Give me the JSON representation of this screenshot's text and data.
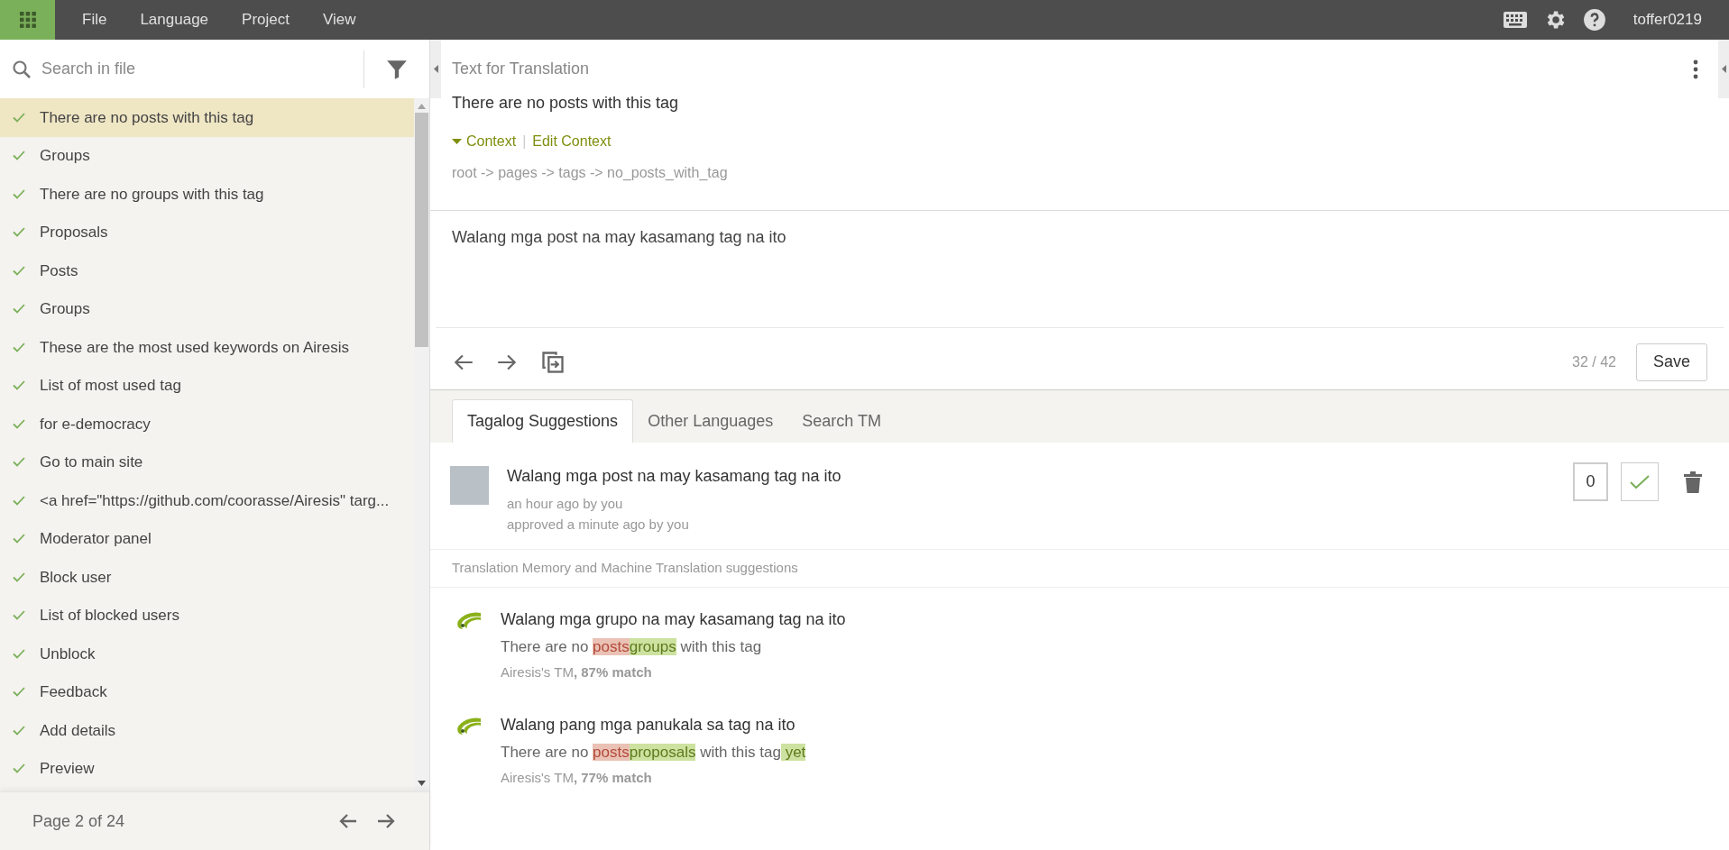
{
  "menu": [
    "File",
    "Language",
    "Project",
    "View"
  ],
  "user": "toffer0219",
  "search": {
    "placeholder": "Search in file"
  },
  "entries": [
    {
      "text": "There are no posts with this tag",
      "approved": true,
      "selected": true
    },
    {
      "text": "Groups",
      "approved": true,
      "selected": false
    },
    {
      "text": "There are no groups with this tag",
      "approved": true,
      "selected": false
    },
    {
      "text": "Proposals",
      "approved": true,
      "selected": false
    },
    {
      "text": "Posts",
      "approved": true,
      "selected": false
    },
    {
      "text": "Groups",
      "approved": true,
      "selected": false
    },
    {
      "text": "These are the most used keywords on Airesis",
      "approved": true,
      "selected": false
    },
    {
      "text": "List of most used tag",
      "approved": true,
      "selected": false
    },
    {
      "text": "for e-democracy",
      "approved": true,
      "selected": false
    },
    {
      "text": "Go to main site",
      "approved": true,
      "selected": false
    },
    {
      "text": "<a href=\"https://github.com/coorasse/Airesis\" targ...",
      "approved": true,
      "selected": false
    },
    {
      "text": "Moderator panel",
      "approved": true,
      "selected": false
    },
    {
      "text": "Block user",
      "approved": true,
      "selected": false
    },
    {
      "text": "List of blocked users",
      "approved": true,
      "selected": false
    },
    {
      "text": "Unblock",
      "approved": true,
      "selected": false
    },
    {
      "text": "Feedback",
      "approved": true,
      "selected": false
    },
    {
      "text": "Add details",
      "approved": true,
      "selected": false
    },
    {
      "text": "Preview",
      "approved": true,
      "selected": false
    }
  ],
  "pagination": "Page 2 of 24",
  "source": {
    "heading": "Text for Translation",
    "text": "There are no posts with this tag",
    "context_toggle": "Context",
    "separator": "|",
    "edit_context": "Edit Context",
    "path": "root -> pages -> tags -> no_posts_with_tag"
  },
  "translation": {
    "value": "Walang mga post na may kasamang tag na ito",
    "counter": "32 / 42",
    "save": "Save"
  },
  "tabs": [
    {
      "label": "Tagalog Suggestions",
      "selected": true
    },
    {
      "label": "Other Languages",
      "selected": false
    },
    {
      "label": "Search TM",
      "selected": false
    }
  ],
  "suggestion": {
    "text": "Walang mga post na may kasamang tag na ito",
    "created": "an hour ago by you",
    "approved_note": "approved a minute ago by you",
    "votes": "0",
    "approved": true
  },
  "tm_heading": "Translation Memory and Machine Translation suggestions",
  "tm": [
    {
      "text": "Walang mga grupo na may kasamang tag na ito",
      "diff": [
        {
          "kind": "same",
          "text": "There are no "
        },
        {
          "kind": "removed",
          "text": "posts"
        },
        {
          "kind": "added",
          "text": "groups"
        },
        {
          "kind": "same",
          "text": " with this tag"
        }
      ],
      "source": "Airesis's TM**, 87% match**"
    },
    {
      "text": "Walang pang mga panukala sa tag na ito",
      "diff": [
        {
          "kind": "same",
          "text": "There are no "
        },
        {
          "kind": "removed",
          "text": "posts"
        },
        {
          "kind": "added",
          "text": "proposals"
        },
        {
          "kind": "same",
          "text": " with this tag"
        },
        {
          "kind": "added",
          "text": " yet"
        }
      ],
      "source": "Airesis's TM**, 77% match**"
    }
  ]
}
